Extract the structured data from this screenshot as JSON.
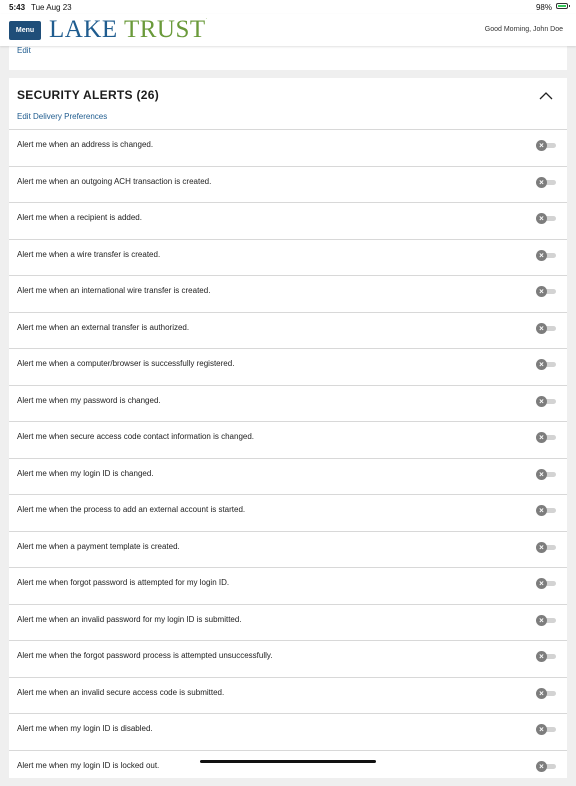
{
  "status_bar": {
    "time": "5:43",
    "date": "Tue Aug 23",
    "battery": "98%",
    "battery_color": "#34c759"
  },
  "header": {
    "menu_label": "Menu",
    "logo_word1": "LAKE",
    "logo_word2": "TRUST",
    "logo_mark": ".",
    "greeting": "Good Morning, John Doe",
    "brand_blue": "#1f5c8f",
    "brand_green": "#6a9a3a"
  },
  "top_card": {
    "edit_label": "Edit"
  },
  "security_alerts": {
    "title": "SECURITY ALERTS (26)",
    "collapse_icon": "chevron-up-icon",
    "edit_delivery_label": "Edit Delivery Preferences",
    "toggle_icon": "x-icon",
    "alerts": [
      {
        "label": "Alert me when an address is changed.",
        "enabled": false
      },
      {
        "label": "Alert me when an outgoing ACH transaction is created.",
        "enabled": false
      },
      {
        "label": "Alert me when a recipient is added.",
        "enabled": false
      },
      {
        "label": "Alert me when a wire transfer is created.",
        "enabled": false
      },
      {
        "label": "Alert me when an international wire transfer is created.",
        "enabled": false
      },
      {
        "label": "Alert me when an external transfer is authorized.",
        "enabled": false
      },
      {
        "label": "Alert me when a computer/browser is successfully registered.",
        "enabled": false
      },
      {
        "label": "Alert me when my password is changed.",
        "enabled": false
      },
      {
        "label": "Alert me when secure access code contact information is changed.",
        "enabled": false
      },
      {
        "label": "Alert me when my login ID is changed.",
        "enabled": false
      },
      {
        "label": "Alert me when the process to add an external account is started.",
        "enabled": false
      },
      {
        "label": "Alert me when a payment template is created.",
        "enabled": false
      },
      {
        "label": "Alert me when forgot password is attempted for my login ID.",
        "enabled": false
      },
      {
        "label": "Alert me when an invalid password for my login ID is submitted.",
        "enabled": false
      },
      {
        "label": "Alert me when the forgot password process is attempted unsuccessfully.",
        "enabled": false
      },
      {
        "label": "Alert me when an invalid secure access code is submitted.",
        "enabled": false
      },
      {
        "label": "Alert me when my login ID is disabled.",
        "enabled": false
      },
      {
        "label": "Alert me when my login ID is locked out.",
        "enabled": false
      }
    ]
  }
}
